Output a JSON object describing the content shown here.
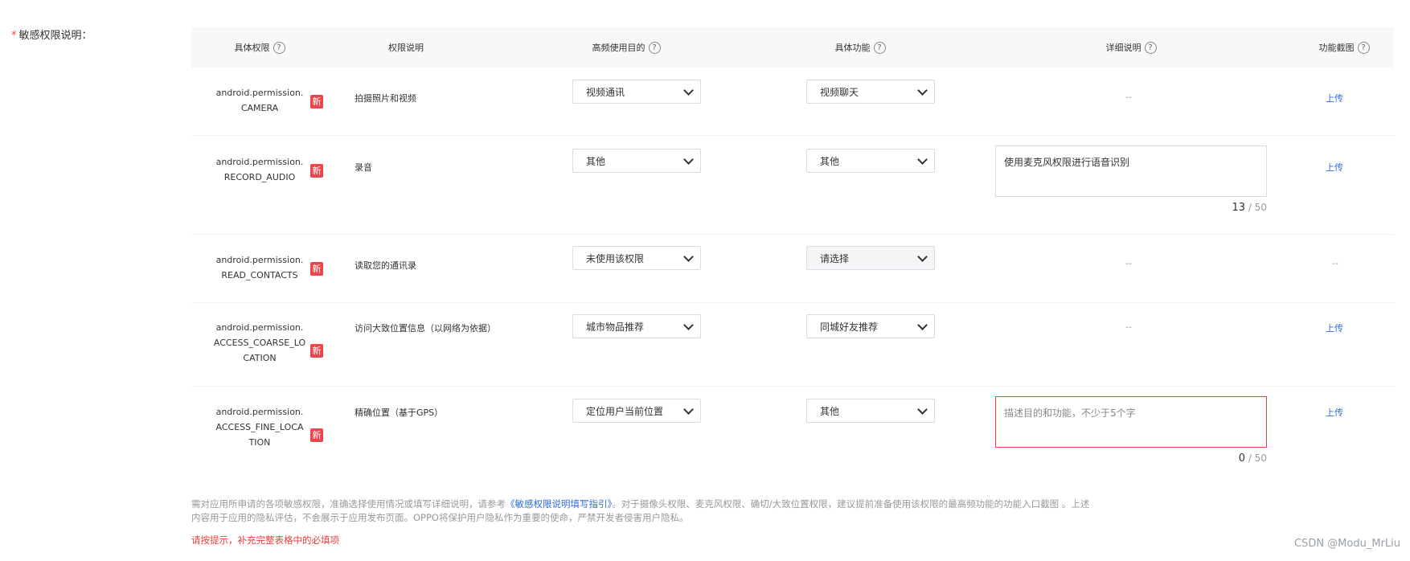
{
  "field_label": {
    "required_mark": "*",
    "text": "敏感权限说明："
  },
  "headers": {
    "perm": "具体权限",
    "desc": "权限说明",
    "purpose": "高频使用目的",
    "feature": "具体功能",
    "detail": "详细说明",
    "screenshot": "功能截图",
    "help_glyph": "?"
  },
  "rows": [
    {
      "perm_lines": [
        "android.permission.",
        "CAMERA"
      ],
      "badge": "新",
      "desc": "拍摄照片和视频",
      "purpose": "视频通讯",
      "feature": "视频聊天",
      "detail": "--",
      "screenshot": "上传"
    },
    {
      "perm_lines": [
        "android.permission.",
        "RECORD_AUDIO"
      ],
      "badge": "新",
      "desc": "录音",
      "purpose": "其他",
      "feature": "其他",
      "detail_text": "使用麦克风权限进行语音识别",
      "count": "13",
      "max": "/ 50",
      "screenshot": "上传"
    },
    {
      "perm_lines": [
        "android.permission.",
        "READ_CONTACTS"
      ],
      "badge": "新",
      "desc": "读取您的通讯录",
      "purpose": "未使用该权限",
      "feature": "请选择",
      "detail": "--",
      "screenshot": "--"
    },
    {
      "perm_lines": [
        "android.permission.",
        "ACCESS_COARSE_LO",
        "CATION"
      ],
      "badge": "新",
      "desc": "访问大致位置信息（以网络为依据）",
      "purpose": "城市物品推荐",
      "feature": "同城好友推荐",
      "detail": "--",
      "screenshot": "上传"
    },
    {
      "perm_lines": [
        "android.permission.",
        "ACCESS_FINE_LOCA",
        "TION"
      ],
      "badge": "新",
      "desc": "精确位置（基于GPS）",
      "purpose": "定位用户当前位置",
      "feature": "其他",
      "detail_placeholder": "描述目的和功能，不少于5个字",
      "count": "0",
      "max": "/ 50",
      "screenshot": "上传"
    }
  ],
  "note": {
    "part1": "需对应用所申请的各项敏感权限，准确选择使用情况或填写详细说明，请参考",
    "link": "《敏感权限说明填写指引》",
    "part2": "。对于摄像头权限、麦克风权限、确切/大致位置权限，建议提前准备使用该权限的最高频功能的功能入口截图 。上述内容用于应用的隐私评估，不会展示于应用发布页面。OPPO将保护用户隐私作为重要的使命，严禁开发者侵害用户隐私。"
  },
  "warning": "请按提示，补充完整表格中的必填项",
  "watermark": "CSDN @Modu_MrLiu",
  "colors": {
    "error": "#ec3b3b",
    "link": "#2f6bda",
    "badge": "#e8474b"
  }
}
